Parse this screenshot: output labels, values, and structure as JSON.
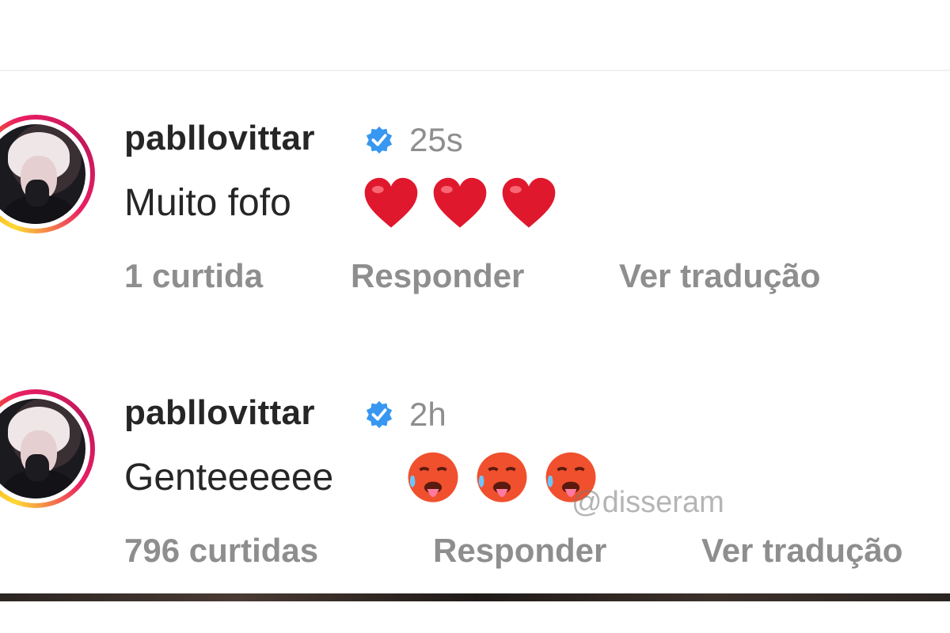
{
  "comments": [
    {
      "username": "pabllovittar",
      "time": "25s",
      "text": "Muito fofo",
      "emojis": [
        "red-heart",
        "red-heart",
        "red-heart"
      ],
      "likes": "1 curtida",
      "reply": "Responder",
      "translate": "Ver tradução"
    },
    {
      "username": "pabllovittar",
      "time": "2h",
      "text": "Genteeeeee",
      "emojis": [
        "hot-face",
        "hot-face",
        "hot-face"
      ],
      "likes": "796 curtidas",
      "reply": "Responder",
      "translate": "Ver tradução"
    }
  ],
  "watermark": "@disseram",
  "colors": {
    "verified": "#3897f0",
    "heart": "#e0182e",
    "hot_face": "#f0502e",
    "text": "#262626",
    "muted": "#8e8e8e"
  }
}
